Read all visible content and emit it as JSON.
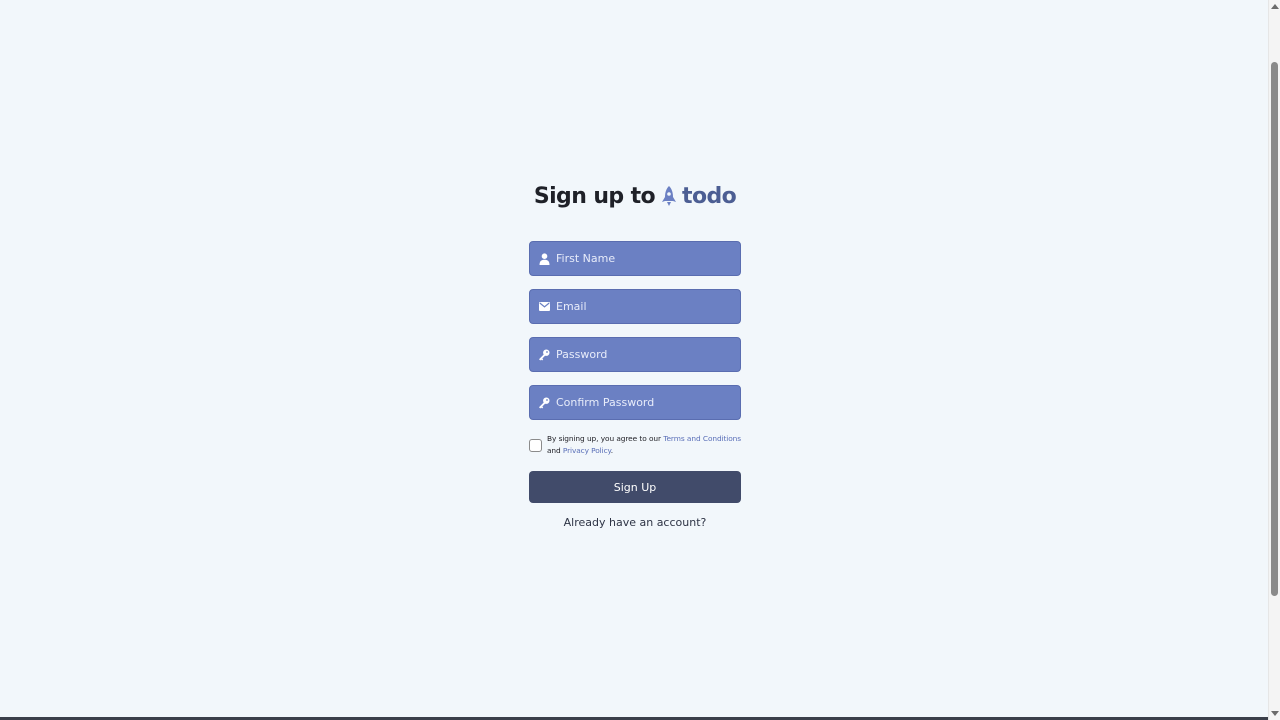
{
  "title": {
    "prefix": "Sign up to",
    "brand": "todo",
    "brand_icon": "rocket-icon"
  },
  "form": {
    "first_name": {
      "placeholder": "First Name",
      "value": "",
      "icon": "user-icon"
    },
    "email": {
      "placeholder": "Email",
      "value": "",
      "icon": "envelope-icon"
    },
    "password": {
      "placeholder": "Password",
      "value": "",
      "icon": "key-icon"
    },
    "confirm_password": {
      "placeholder": "Confirm Password",
      "value": "",
      "icon": "key-icon"
    },
    "agreement": {
      "checked": false,
      "text_before": "By signing up, you agree to our",
      "terms_link": "Terms and Conditions",
      "text_between": "and",
      "privacy_link": "Privacy Policy",
      "text_after": "."
    },
    "submit_label": "Sign Up",
    "login_link": "Already have an account?"
  },
  "colors": {
    "background": "#f2f7fb",
    "input_fill": "#6b80c3",
    "button_fill": "#414b6a",
    "brand": "#4c5e93",
    "link": "#5a6fb8"
  }
}
